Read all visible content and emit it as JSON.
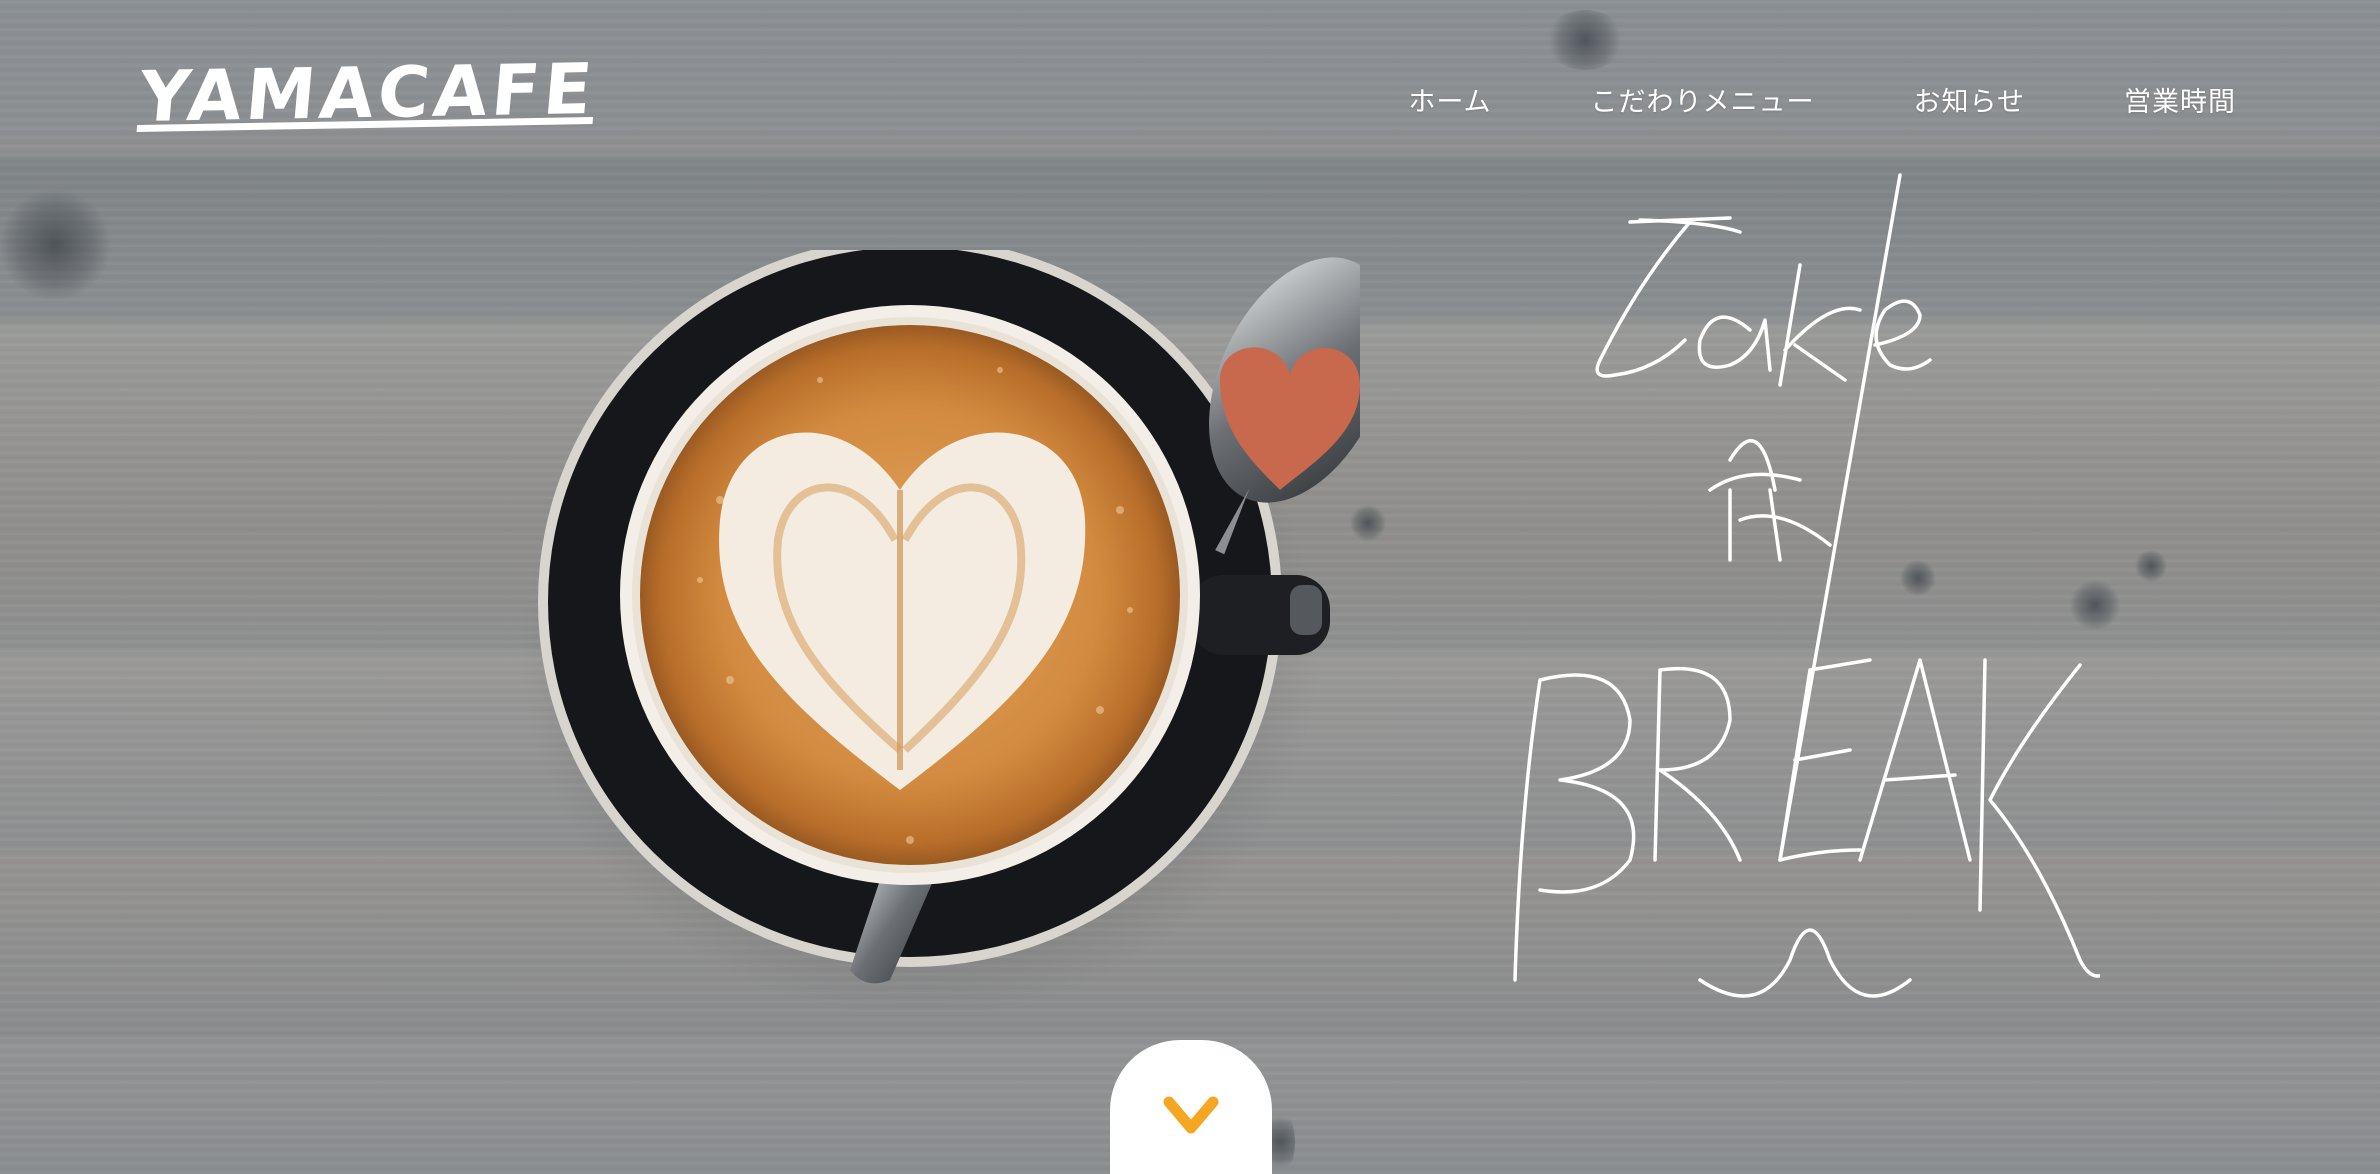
{
  "site": {
    "logo_text": "YAMACAFE"
  },
  "nav": {
    "items": [
      {
        "label": "ホーム"
      },
      {
        "label": "こだわりメニュー"
      },
      {
        "label": "お知らせ"
      },
      {
        "label": "営業時間"
      }
    ]
  },
  "hero": {
    "handwritten_text": "Take A BREAK",
    "image_subject": "latte-art-coffee-icon"
  },
  "scroll": {
    "icon": "chevron-down-icon"
  },
  "colors": {
    "accent": "#f5a623",
    "text": "#ffffff",
    "background": "#8d8f91"
  }
}
